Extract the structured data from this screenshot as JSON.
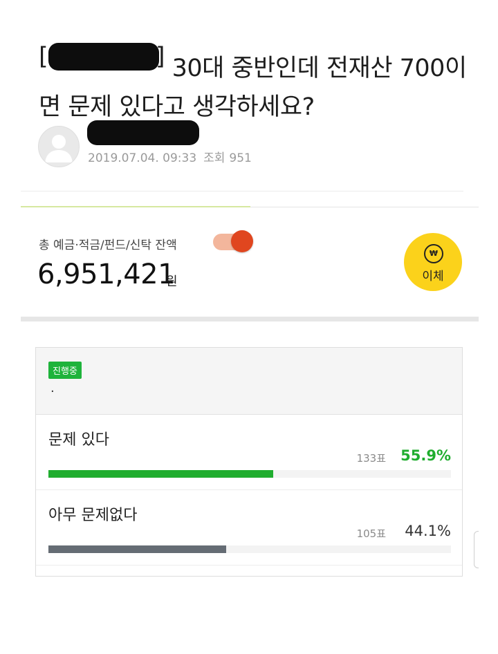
{
  "post": {
    "title_bracket_open": "[",
    "title_bracket_close": "]",
    "title_text": " 30대 중반인데 전재산 700이면 문제 있다고 생각하세요?",
    "date": "2019.07.04. 09:33",
    "views_label": "조회",
    "views": "951"
  },
  "account": {
    "label": "총 예금·적금/펀드/신탁 잔액",
    "balance": "6,951,421",
    "unit": "원",
    "toggle_on": true,
    "transfer_label": "이체",
    "transfer_icon_glyph": "₩"
  },
  "poll": {
    "status_badge": "진행중",
    "question": "·",
    "options": [
      {
        "label": "문제 있다",
        "votes": "133표",
        "percent": "55.9%",
        "fraction": 0.559,
        "color": "#20ad2f",
        "pct_color": "#20ad2f"
      },
      {
        "label": "아무 문제없다",
        "votes": "105표",
        "percent": "44.1%",
        "fraction": 0.441,
        "color": "#656c74",
        "pct_color": "#333333"
      }
    ]
  },
  "icons": {
    "avatar": "user-silhouette-icon",
    "transfer": "won-coin-icon"
  }
}
